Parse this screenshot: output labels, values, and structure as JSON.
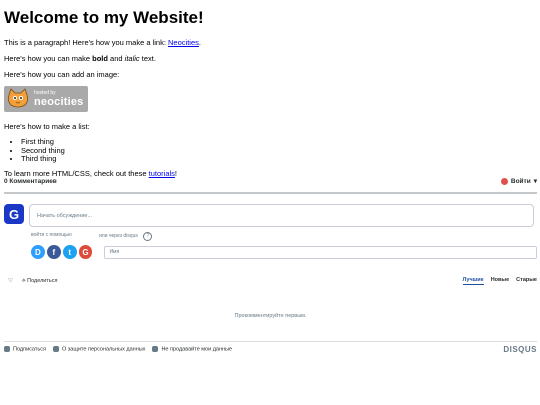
{
  "heading": "Welcome to my Website!",
  "para1": {
    "before": "This is a paragraph! Here's how you make a link: ",
    "link": "Neocities",
    "after": "."
  },
  "para2": {
    "before": "Here's how you can make ",
    "bold": "bold",
    "mid": " and ",
    "italic": "italic",
    "after": " text."
  },
  "para3": "Here's how you can add an image:",
  "badge": {
    "small": "hosted by",
    "big": "neocities"
  },
  "para4": "Here's how to make a list:",
  "list": [
    "First thing",
    "Second thing",
    "Third thing"
  ],
  "para5": {
    "before": "To learn more HTML/CSS, check out these ",
    "link": "tutorials",
    "after": "!"
  },
  "disqus": {
    "count": "0 Комментариев",
    "login": "Войти",
    "avatar_letter": "G",
    "compose_placeholder": "Начать обсуждение...",
    "login_with": "войти с помощью",
    "or_disqus": "или через disqus",
    "help": "?",
    "social": [
      {
        "letter": "D",
        "color": "#2e9fff"
      },
      {
        "letter": "f",
        "color": "#3b5998"
      },
      {
        "letter": "t",
        "color": "#1da1f2"
      },
      {
        "letter": "G",
        "color": "#dd4b39"
      }
    ],
    "name_placeholder": "Имя",
    "share": "Поделиться",
    "tabs": [
      "Лучшие",
      "Новые",
      "Старые"
    ],
    "empty": "Прокомментируйте первым.",
    "footer": [
      "Подписаться",
      "О защите персональных данных",
      "Не продавайте мои данные"
    ],
    "logo": "DISQUS"
  }
}
